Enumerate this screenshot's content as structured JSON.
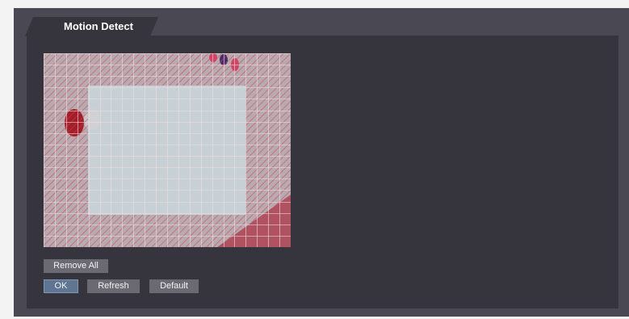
{
  "tab": {
    "title": "Motion Detect"
  },
  "camera": {
    "grid_columns": 22,
    "grid_rows": 17,
    "colors": {
      "grid_line": "#f2dede",
      "selection_hatch": "#cf3f4f",
      "unselected_fill": "#c7d0d5"
    }
  },
  "buttons": {
    "remove_all": "Remove All",
    "ok": "OK",
    "refresh": "Refresh",
    "default": "Default"
  }
}
